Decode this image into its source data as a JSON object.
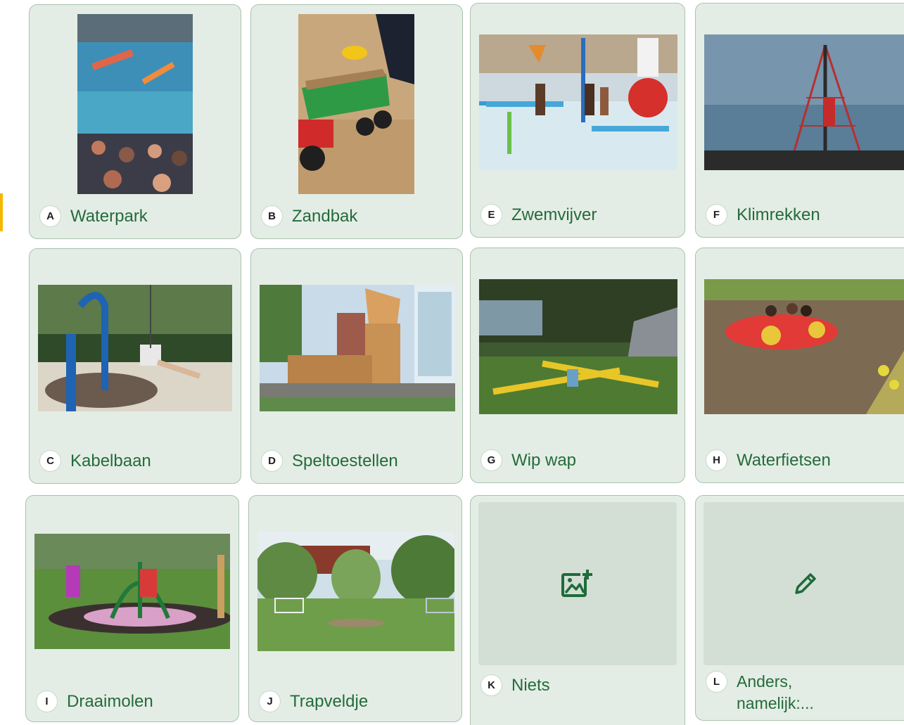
{
  "options": [
    {
      "letter": "A",
      "label": "Waterpark",
      "image": "waterpark-photo"
    },
    {
      "letter": "B",
      "label": "Zandbak",
      "image": "sandbox-photo"
    },
    {
      "letter": "E",
      "label": "Zwemvijver",
      "image": "swimming-pond-photo"
    },
    {
      "letter": "F",
      "label": "Klimrekken",
      "image": "climbing-frame-photo"
    },
    {
      "letter": "C",
      "label": "Kabelbaan",
      "image": "zipline-photo"
    },
    {
      "letter": "D",
      "label": "Speltoestellen",
      "image": "playground-equipment-photo"
    },
    {
      "letter": "G",
      "label": "Wip wap",
      "image": "seesaw-photo"
    },
    {
      "letter": "H",
      "label": "Waterfietsen",
      "image": "pedal-boat-photo"
    },
    {
      "letter": "I",
      "label": "Draaimolen",
      "image": "merry-go-round-photo"
    },
    {
      "letter": "J",
      "label": "Trapveldje",
      "image": "football-field-photo"
    },
    {
      "letter": "K",
      "label": "Niets",
      "image": "add-image-icon"
    },
    {
      "letter": "L",
      "label": "Anders, namelijk:...",
      "image": "pencil-icon"
    }
  ],
  "colors": {
    "card_background": "#e4ede5",
    "card_border": "#a9c2ad",
    "label_text": "#246b3c",
    "accent": "#f5b800",
    "icon": "#1f6b3a"
  }
}
